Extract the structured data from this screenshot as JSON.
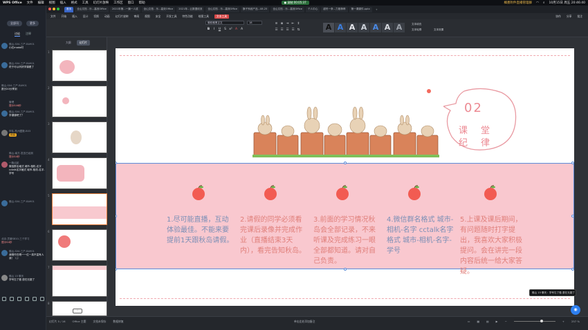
{
  "menubar": {
    "app": "WPS Office",
    "items": [
      "文件",
      "编辑",
      "视图",
      "插入",
      "格式",
      "工具",
      "幻灯片放映",
      "工作区",
      "窗口",
      "帮助"
    ],
    "recording": "● 录制 00:05:37",
    "live": "橘墨附件直播管理群",
    "clock": "10月15日 周五 20:46:40"
  },
  "chat": {
    "btn_all": "全部讯",
    "btn_more": "更多",
    "tab_discuss": "讨论",
    "tab_members": "注释",
    "messages": [
      {
        "name": "佛山-S04-三产-BA901",
        "text": "小红mada时"
      },
      {
        "name": "佛山-S04-三产-BA901",
        "text": "终于可以听好学课看了"
      },
      {
        "name": "佛山-S04-三产-BA901",
        "text": "愿分20分享到"
      },
      {
        "name": "管理",
        "text": "提示S46秒"
      },
      {
        "name": "佛山-S04-三产-BA901",
        "text": "学课课吧了？"
      },
      {
        "name": "市队-杭州暨数-B03",
        "text": "欢迎"
      },
      {
        "name": "佛山-南方-发言已经到",
        "text": "提示S4秒"
      },
      {
        "name": "一跑点起",
        "text": "微信群名格式 城市-相机-名字 cctalk名字格式 城市-相机-名字-学号"
      },
      {
        "name": "佛山-S04-三产-BA901",
        "text": ""
      },
      {
        "name": "北京-员景S810-三个学习",
        "text": "提示S4秒"
      },
      {
        "name": "佛山-S04-三产-BA901",
        "text": "我刚作在喝一一位一真不温有人我！（-）"
      },
      {
        "name": "佛山 15 聊天",
        "text": "学号忘了做 退在无疑了"
      }
    ]
  },
  "tabs": {
    "items": [
      "首页",
      "全山文档 - 乐...高效Office",
      "2021年第...一篇一人成",
      "全山文档 - 乐...高效Office",
      "2021年...云数据线流",
      "全山文档 - 乐...高效Office",
      "酥子系统产品...08.25",
      "全山文档 - 乐...高效Office",
      "个人中心",
      "越冬一条...力推荐荐",
      "第一课课件.pptx"
    ],
    "active_index": 0
  },
  "ribbon_menu": {
    "items": [
      "文件",
      "开始",
      "插入",
      "设计",
      "切换",
      "动画",
      "幻灯片放映",
      "审阅",
      "视图",
      "安全",
      "开发工具",
      "特色功能",
      "绘图工具",
      "文本工具"
    ],
    "active": "文本工具",
    "right": [
      "协作",
      "分享",
      "批注"
    ]
  },
  "ribbon": {
    "font_name": "微软雅黑正文",
    "font_size": "18",
    "text_fill": "文本填充",
    "text_outline": "文本轮廓",
    "text_effect": "文本效果"
  },
  "thumbs": {
    "tab_outline": "大纲",
    "tab_slides": "幻灯片",
    "numbers": [
      "1",
      "2",
      "3",
      "4",
      "5",
      "6",
      "7",
      "8",
      "9"
    ],
    "selected": 4
  },
  "slide": {
    "badge_num": "02",
    "badge_chars": [
      "课",
      "堂",
      "纪",
      "律"
    ],
    "columns": [
      {
        "text": "1.尽可能直播，互动体验最佳。不能来要提前1天跟秋岛请假。",
        "color": "blue"
      },
      {
        "text": "2.请假的同学必须看完课后录像并完成作业（直播结束3天内），看完告知秋岛。",
        "color": "red"
      },
      {
        "text": "3.前面的学习情况秋岛会全部记录，不来听课及完成练习一眼全部都知道。请对自己负责。",
        "color": "red"
      },
      {
        "text": "4.微信群名格式 城市-相机-名字 cctalk名字格式 城市-相机-名字-学号",
        "color": "blue"
      },
      {
        "text": "5.上课及课后期间，有问题随时打字提出，我喜欢大家积极提问。会在讲完一段内容后统一给大家答疑。",
        "color": "red"
      }
    ]
  },
  "status": {
    "slide_pos": "幻灯片 5 / 16",
    "theme": "Office 主题",
    "missing_font": "文档未保存",
    "restore": "数据修复",
    "notes": "单击此处添加备注",
    "zoom": "257 %"
  },
  "toast": "佛山 15 聊天：学号忘了做 退在无疑了",
  "colors": {
    "accent": "#3a66c7",
    "band": "#f9c8cf",
    "slide_text_red": "#e07f7a",
    "slide_text_blue": "#7b8fb6"
  }
}
